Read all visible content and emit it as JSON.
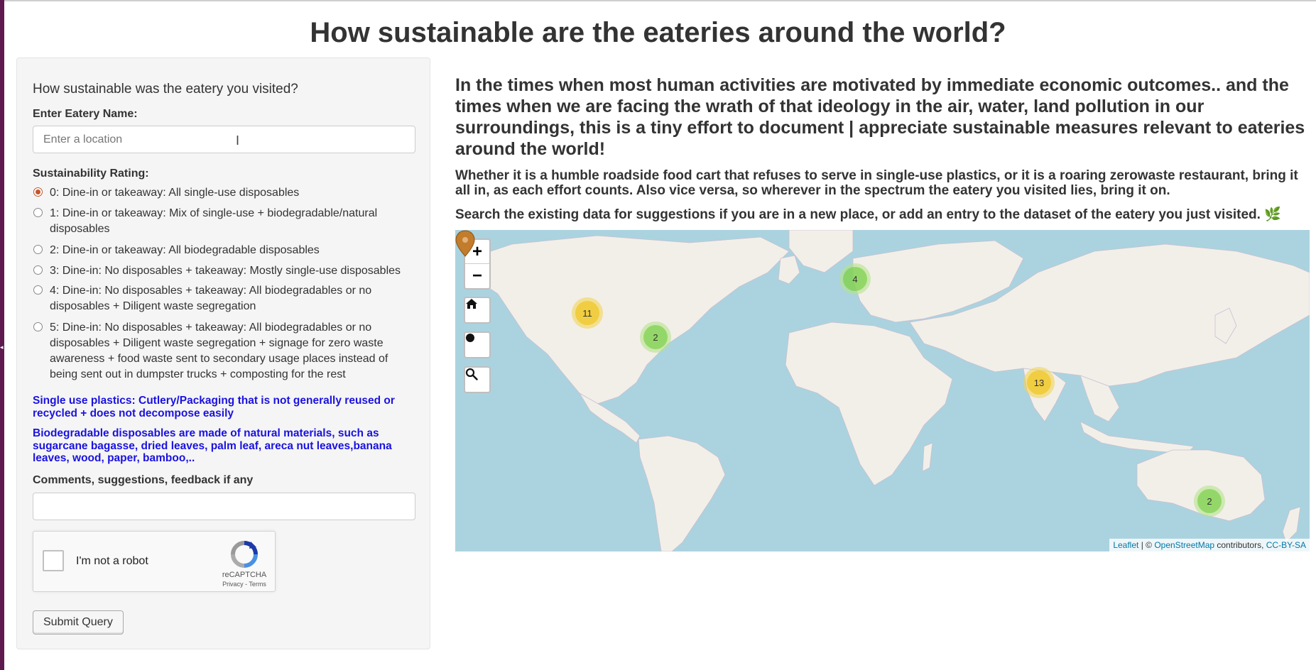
{
  "page": {
    "title": "How sustainable are the eateries around the world?"
  },
  "form": {
    "heading": "How sustainable was the eatery you visited?",
    "eatery_label": "Enter Eatery Name:",
    "eatery_placeholder": "Enter a location",
    "eatery_value": "",
    "rating_label": "Sustainability Rating:",
    "rating_options": [
      {
        "label": "0: Dine-in or takeaway: All single-use disposables",
        "checked": true
      },
      {
        "label": "1: Dine-in or takeaway: Mix of single-use + biodegradable/natural disposables",
        "checked": false
      },
      {
        "label": "2: Dine-in or takeaway: All biodegradable disposables",
        "checked": false
      },
      {
        "label": "3: Dine-in: No disposables + takeaway: Mostly single-use disposables",
        "checked": false
      },
      {
        "label": "4: Dine-in: No disposables + takeaway: All biodegradables or no disposables + Diligent waste segregation",
        "checked": false
      },
      {
        "label": "5: Dine-in: No disposables + takeaway: All biodegradables or no disposables + Diligent waste segregation + signage for zero waste awareness + food waste sent to secondary usage places instead of being sent out in dumpster trucks + composting for the rest",
        "checked": false
      }
    ],
    "note_plastics": "Single use plastics: Cutlery/Packaging that is not generally reused or recycled + does not decompose easily",
    "note_biodegradable": "Biodegradable disposables are made of natural materials, such as sugarcane bagasse, dried leaves, palm leaf, areca nut leaves,banana leaves, wood, paper, bamboo,..",
    "comments_label": "Comments, suggestions, feedback if any",
    "comments_value": "",
    "captcha": {
      "label": "I'm not a robot",
      "brand": "reCAPTCHA",
      "privacy": "Privacy",
      "separator": " - ",
      "terms": "Terms"
    },
    "submit_label": "Submit Query"
  },
  "main": {
    "intro": "In the times when most human activities are motivated by immediate economic outcomes.. and the times when we are facing the wrath of that ideology in the air, water, land pollution in our surroundings, this is a tiny effort to document | appreciate sustainable measures relevant to eateries around the world!",
    "para1": "Whether it is a humble roadside food cart that refuses to serve in single-use plastics, or it is a roaring zerowaste restaurant, bring it all in, as each effort counts. Also vice versa, so wherever in the spectrum the eatery you visited lies, bring it on.",
    "para2": "Search the existing data for suggestions if you are in a new place, or add an entry to the dataset of the eatery you just visited. 🌿"
  },
  "map": {
    "zoom_in": "+",
    "zoom_out": "−",
    "buttons": [
      "home-icon",
      "locate-dot-icon",
      "search-icon"
    ],
    "clusters": [
      {
        "count": "11",
        "color": "yellow",
        "region": "western-usa"
      },
      {
        "count": "2",
        "color": "green",
        "region": "southeastern-usa"
      },
      {
        "count": "4",
        "color": "green",
        "region": "western-europe"
      },
      {
        "count": "13",
        "color": "yellow",
        "region": "southern-india"
      },
      {
        "count": "2",
        "color": "green",
        "region": "southeastern-australia"
      }
    ],
    "marker": {
      "icon": "map-pin-icon",
      "color": "#c27c2c",
      "region": "sumatra"
    },
    "attribution": {
      "leaflet": "Leaflet",
      "sep": " | © ",
      "osm": "OpenStreetMap",
      "contrib": " contributors, ",
      "license": "CC-BY-SA"
    },
    "colors": {
      "ocean": "#aad3df",
      "land": "#f2efe9",
      "cluster_green": "#6ecc39",
      "cluster_yellow": "#f0c20c"
    }
  }
}
